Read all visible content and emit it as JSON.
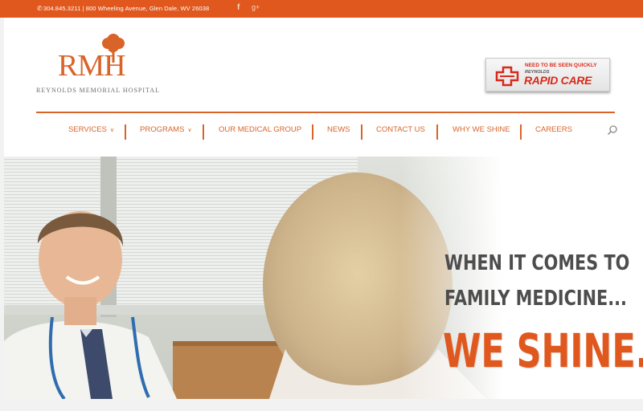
{
  "topbar": {
    "contact": "304.845.3211 | 800 Wheeling Avenue, Glen Dale, WV 26038",
    "social": {
      "facebook": "f",
      "googleplus": "g+"
    }
  },
  "logo": {
    "letters": "RMH",
    "subtitle": "REYNOLDS MEMORIAL HOSPITAL"
  },
  "rapid_care": {
    "tagline": "NEED TO BE SEEN QUICKLY",
    "brand": "REYNOLDS",
    "name": "RAPID CARE"
  },
  "nav": {
    "items": [
      {
        "label": "SERVICES",
        "caret": "∨"
      },
      {
        "label": "PROGRAMS",
        "caret": "∨"
      },
      {
        "label": "OUR MEDICAL GROUP"
      },
      {
        "label": "NEWS"
      },
      {
        "label": "CONTACT US"
      },
      {
        "label": "WHY WE SHINE"
      },
      {
        "label": "CAREERS"
      }
    ]
  },
  "hero": {
    "line1": "WHEN IT COMES TO",
    "line2": "FAMILY MEDICINE...",
    "line3": "WE SHINE."
  },
  "colors": {
    "accent": "#e0581e",
    "nav_text": "#d9642a",
    "rapid_red": "#d82a1a"
  }
}
